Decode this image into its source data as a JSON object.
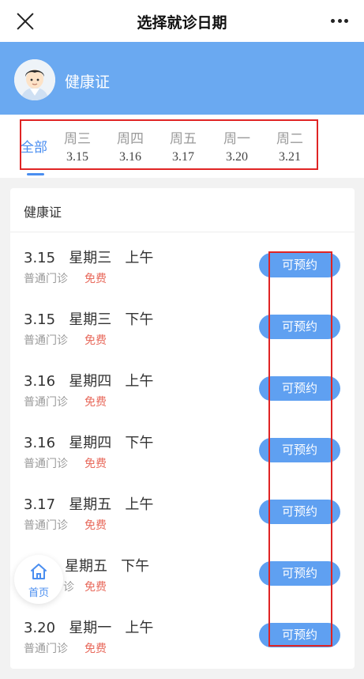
{
  "navbar": {
    "title": "选择就诊日期",
    "close_icon": "close-icon",
    "more_icon": "more-icon"
  },
  "banner": {
    "name": "健康证",
    "avatar": "doctor-avatar"
  },
  "date_tabs": {
    "all_label": "全部",
    "active": "全部",
    "items": [
      {
        "weekday": "周三",
        "date": "3.15"
      },
      {
        "weekday": "周四",
        "date": "3.16"
      },
      {
        "weekday": "周五",
        "date": "3.17"
      },
      {
        "weekday": "周一",
        "date": "3.20"
      },
      {
        "weekday": "周二",
        "date": "3.21"
      }
    ]
  },
  "card": {
    "title": "健康证",
    "slots": [
      {
        "date": "3.15",
        "weekday": "星期三",
        "period": "上午",
        "type": "普通门诊",
        "fee": "免费",
        "action": "可预约"
      },
      {
        "date": "3.15",
        "weekday": "星期三",
        "period": "下午",
        "type": "普通门诊",
        "fee": "免费",
        "action": "可预约"
      },
      {
        "date": "3.16",
        "weekday": "星期四",
        "period": "上午",
        "type": "普通门诊",
        "fee": "免费",
        "action": "可预约"
      },
      {
        "date": "3.16",
        "weekday": "星期四",
        "period": "下午",
        "type": "普通门诊",
        "fee": "免费",
        "action": "可预约"
      },
      {
        "date": "3.17",
        "weekday": "星期五",
        "period": "上午",
        "type": "普通门诊",
        "fee": "免费",
        "action": "可预约"
      },
      {
        "date": "",
        "weekday": "星期五",
        "period": "下午",
        "type": "诊",
        "fee": "免费",
        "action": "可预约"
      },
      {
        "date": "3.20",
        "weekday": "星期一",
        "period": "上午",
        "type": "普通门诊",
        "fee": "免费",
        "action": "可预约"
      }
    ]
  },
  "home_button": {
    "label": "首页",
    "icon": "home-icon"
  },
  "colors": {
    "accent": "#4a8ef0",
    "banner": "#6aa9f1",
    "button": "#5fa0f1",
    "fee": "#e86a5c",
    "highlight_box": "#e02424"
  }
}
